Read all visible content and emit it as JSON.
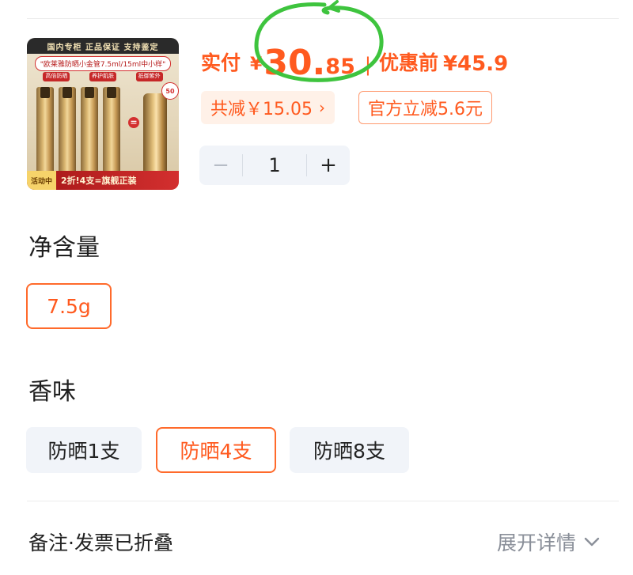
{
  "product": {
    "thumbnail": {
      "top_banner": "国内专柜  正品保证  支持鉴定",
      "pill_text": "\"欧莱雅防晒小金管7.5ml/15ml中小样\"",
      "sub_tags": [
        "高倍防晒",
        "养护肌肤",
        "抵御紫外"
      ],
      "badge": "50",
      "ribbon_tag": "活动中",
      "ribbon_text": "2折!4支=旗舰正装"
    }
  },
  "price": {
    "paid_label": "实付",
    "currency": "¥",
    "amount_int": "30.",
    "amount_dec": "85",
    "separator": "|",
    "before_label": "优惠前",
    "before_price": "¥45.9"
  },
  "discounts": {
    "total": "共减￥15.05",
    "total_chevron": "›",
    "official": "官方立减5.6元"
  },
  "stepper": {
    "minus": "−",
    "quantity": "1",
    "plus": "+"
  },
  "net_content": {
    "title": "净含量",
    "options": [
      {
        "label": "7.5g",
        "selected": true
      }
    ]
  },
  "scent": {
    "title": "香味",
    "options": [
      {
        "label": "防晒1支",
        "selected": false
      },
      {
        "label": "防晒4支",
        "selected": true
      },
      {
        "label": "防晒8支",
        "selected": false
      }
    ]
  },
  "note": {
    "label": "备注·发票已折叠",
    "expand": "展开详情"
  },
  "colors": {
    "accent": "#ff5a1f",
    "annotation": "#3ec43e",
    "option_bg": "#f1f4f9"
  },
  "annotation": {
    "icon": "hand-drawn-circle"
  }
}
